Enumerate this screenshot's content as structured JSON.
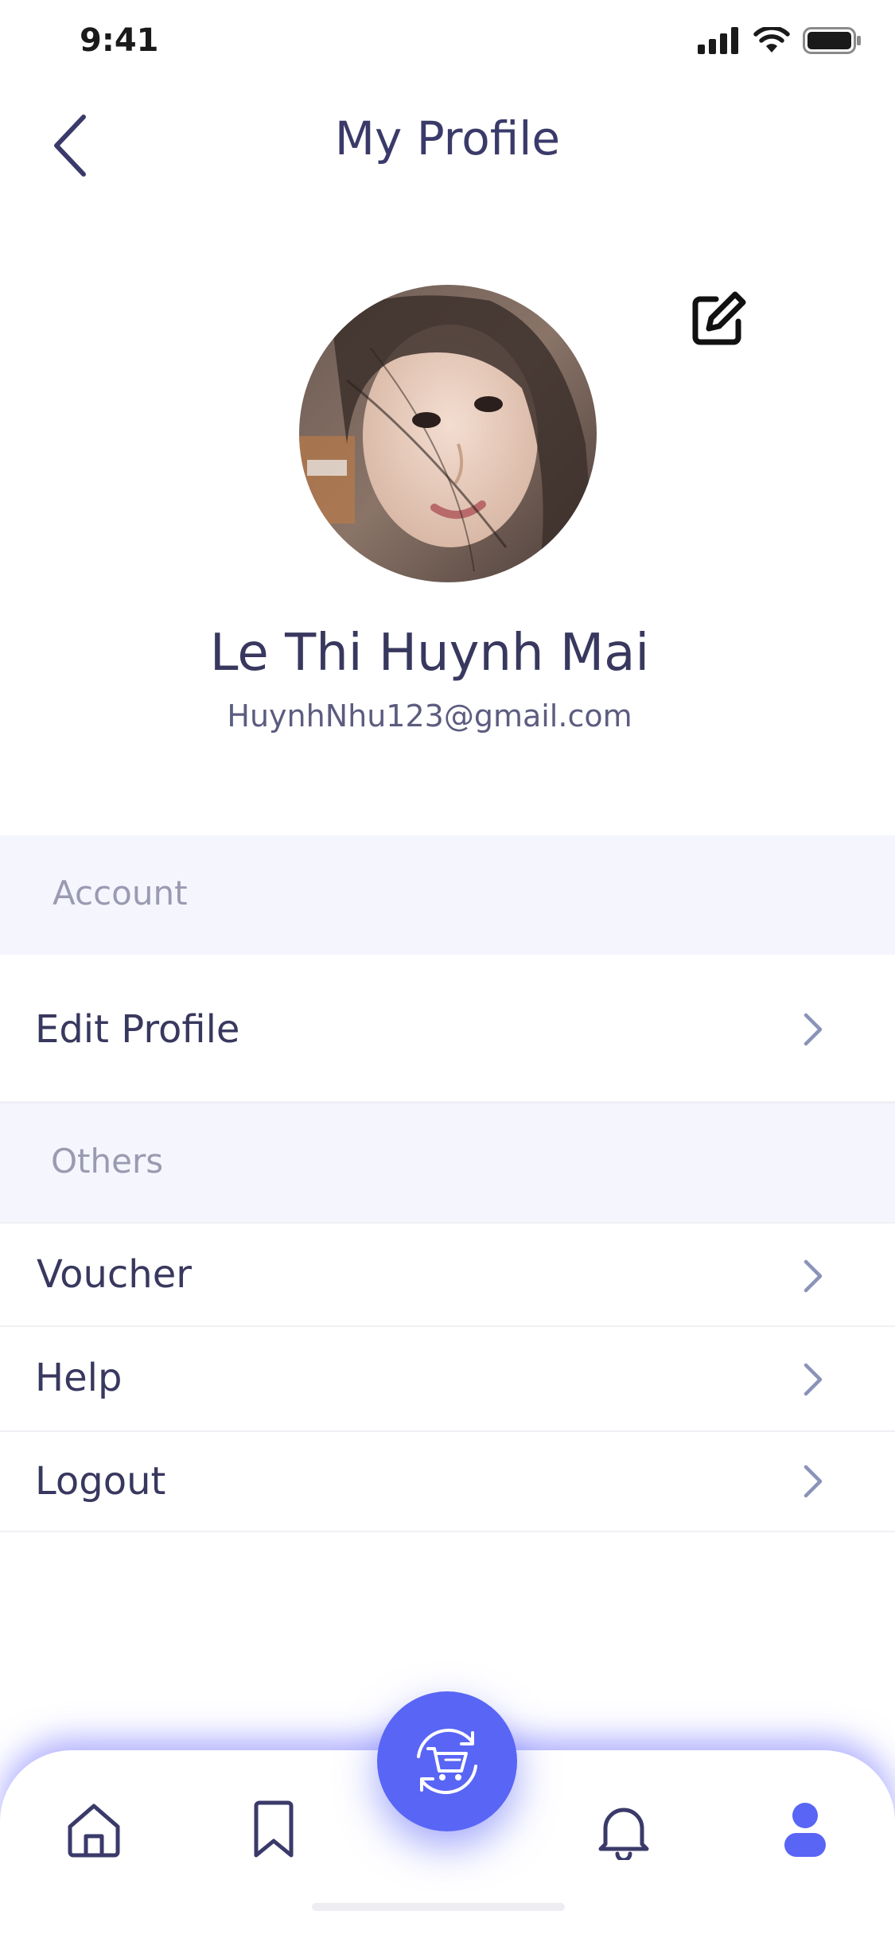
{
  "status_bar": {
    "time": "9:41",
    "icons": [
      "cellular-signal-icon",
      "wifi-icon",
      "battery-icon"
    ]
  },
  "header": {
    "title": "My Profile",
    "back_icon": "chevron-left-icon"
  },
  "profile": {
    "name": "Le Thi Huynh Mai",
    "email": "HuynhNhu123@gmail.com",
    "edit_icon": "edit-square-icon"
  },
  "sections": {
    "account": {
      "title": "Account",
      "items": [
        {
          "label": "Edit Profile"
        }
      ]
    },
    "others": {
      "title": "Others",
      "items": [
        {
          "label": "Voucher"
        },
        {
          "label": "Help"
        },
        {
          "label": "Logout"
        }
      ]
    }
  },
  "bottom_nav": {
    "items": [
      "home-icon",
      "bookmark-icon",
      "cart-refresh-icon",
      "bell-icon",
      "profile-icon"
    ],
    "active": "profile-icon"
  },
  "colors": {
    "primary": "#5965f5",
    "text": "#38385f",
    "muted": "#9a9ab2",
    "section_bg": "#f5f5fd",
    "chevron": "#8a93b8"
  }
}
